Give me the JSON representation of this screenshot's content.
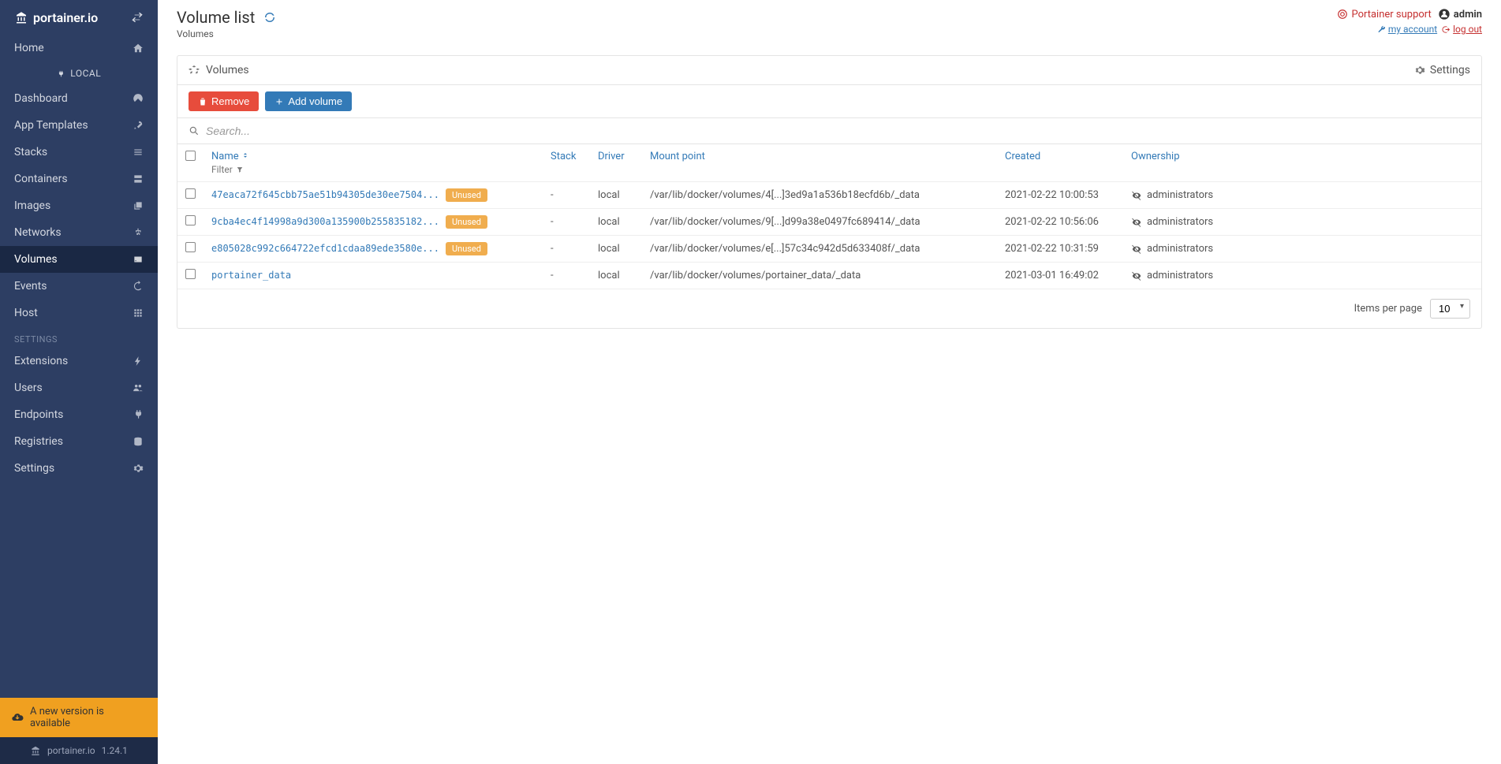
{
  "brand": "portainer.io",
  "sidebar": {
    "home": "Home",
    "env": "LOCAL",
    "items": [
      {
        "label": "Dashboard",
        "icon": "dashboard-icon"
      },
      {
        "label": "App Templates",
        "icon": "rocket-icon"
      },
      {
        "label": "Stacks",
        "icon": "list-icon"
      },
      {
        "label": "Containers",
        "icon": "server-icon"
      },
      {
        "label": "Images",
        "icon": "clone-icon"
      },
      {
        "label": "Networks",
        "icon": "sitemap-icon"
      },
      {
        "label": "Volumes",
        "icon": "hdd-icon",
        "active": true
      },
      {
        "label": "Events",
        "icon": "history-icon"
      },
      {
        "label": "Host",
        "icon": "grid-icon"
      }
    ],
    "settings_header": "SETTINGS",
    "settings": [
      {
        "label": "Extensions",
        "icon": "bolt-icon"
      },
      {
        "label": "Users",
        "icon": "users-icon"
      },
      {
        "label": "Endpoints",
        "icon": "plug-icon"
      },
      {
        "label": "Registries",
        "icon": "database-icon"
      },
      {
        "label": "Settings",
        "icon": "cogs-icon"
      }
    ],
    "update_banner": "A new version is available",
    "version": "1.24.1"
  },
  "header": {
    "title": "Volume list",
    "breadcrumb": "Volumes",
    "support": "Portainer support",
    "user": "admin",
    "my_account": "my account",
    "log_out": "log out"
  },
  "panel": {
    "title": "Volumes",
    "settings_label": "Settings",
    "remove_label": "Remove",
    "add_label": "Add volume",
    "search_placeholder": "Search...",
    "filter_label": "Filter",
    "columns": {
      "name": "Name",
      "stack": "Stack",
      "driver": "Driver",
      "mount": "Mount point",
      "created": "Created",
      "ownership": "Ownership"
    },
    "unused_badge": "Unused",
    "rows": [
      {
        "name": "47eaca72f645cbb75ae51b94305de30ee7504...",
        "unused": true,
        "stack": "-",
        "driver": "local",
        "mount": "/var/lib/docker/volumes/4[...]3ed9a1a536b18ecfd6b/_data",
        "created": "2021-02-22 10:00:53",
        "owner": "administrators"
      },
      {
        "name": "9cba4ec4f14998a9d300a135900b255835182...",
        "unused": true,
        "stack": "-",
        "driver": "local",
        "mount": "/var/lib/docker/volumes/9[...]d99a38e0497fc689414/_data",
        "created": "2021-02-22 10:56:06",
        "owner": "administrators"
      },
      {
        "name": "e805028c992c664722efcd1cdaa89ede3580e...",
        "unused": true,
        "stack": "-",
        "driver": "local",
        "mount": "/var/lib/docker/volumes/e[...]57c34c942d5d633408f/_data",
        "created": "2021-02-22 10:31:59",
        "owner": "administrators"
      },
      {
        "name": "portainer_data",
        "unused": false,
        "stack": "-",
        "driver": "local",
        "mount": "/var/lib/docker/volumes/portainer_data/_data",
        "created": "2021-03-01 16:49:02",
        "owner": "administrators"
      }
    ],
    "items_per_page_label": "Items per page",
    "items_per_page": "10"
  }
}
